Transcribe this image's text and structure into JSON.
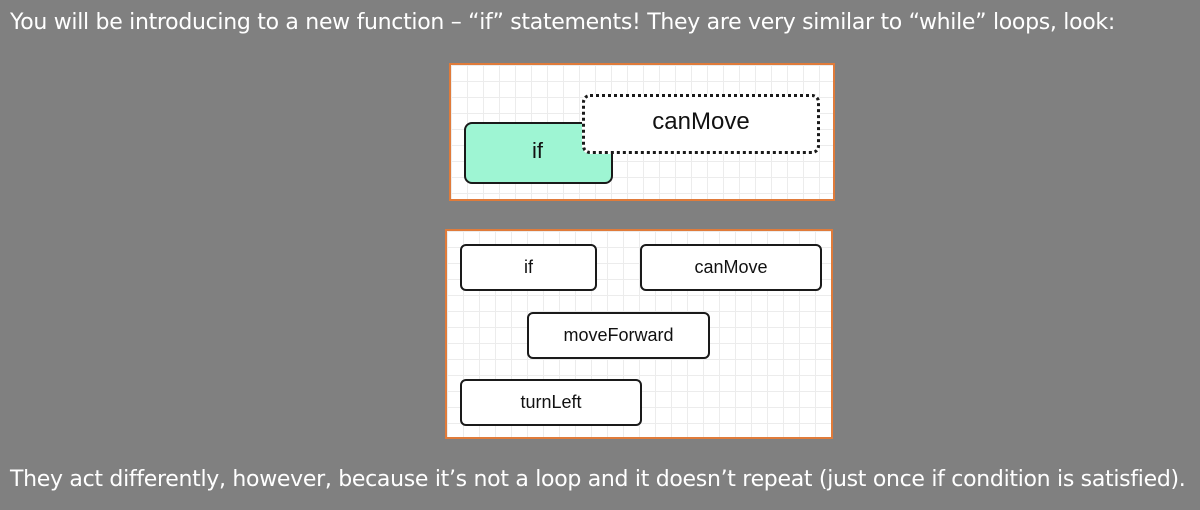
{
  "intro_text": "You will be introducing to a new function – “if” statements! They are very similar to “while” loops, look:",
  "outro_text": "They act differently, however, because it’s not a loop and it doesn’t repeat (just once if condition is satisfied).",
  "top_panel": {
    "if_block": "if",
    "condition_slot": "canMove"
  },
  "bottom_panel": {
    "blocks": [
      "if",
      "canMove",
      "moveForward",
      "turnLeft"
    ]
  },
  "colors": {
    "background": "#808080",
    "panel_border": "#e07b3a",
    "if_block_fill": "#9ef5d3"
  }
}
